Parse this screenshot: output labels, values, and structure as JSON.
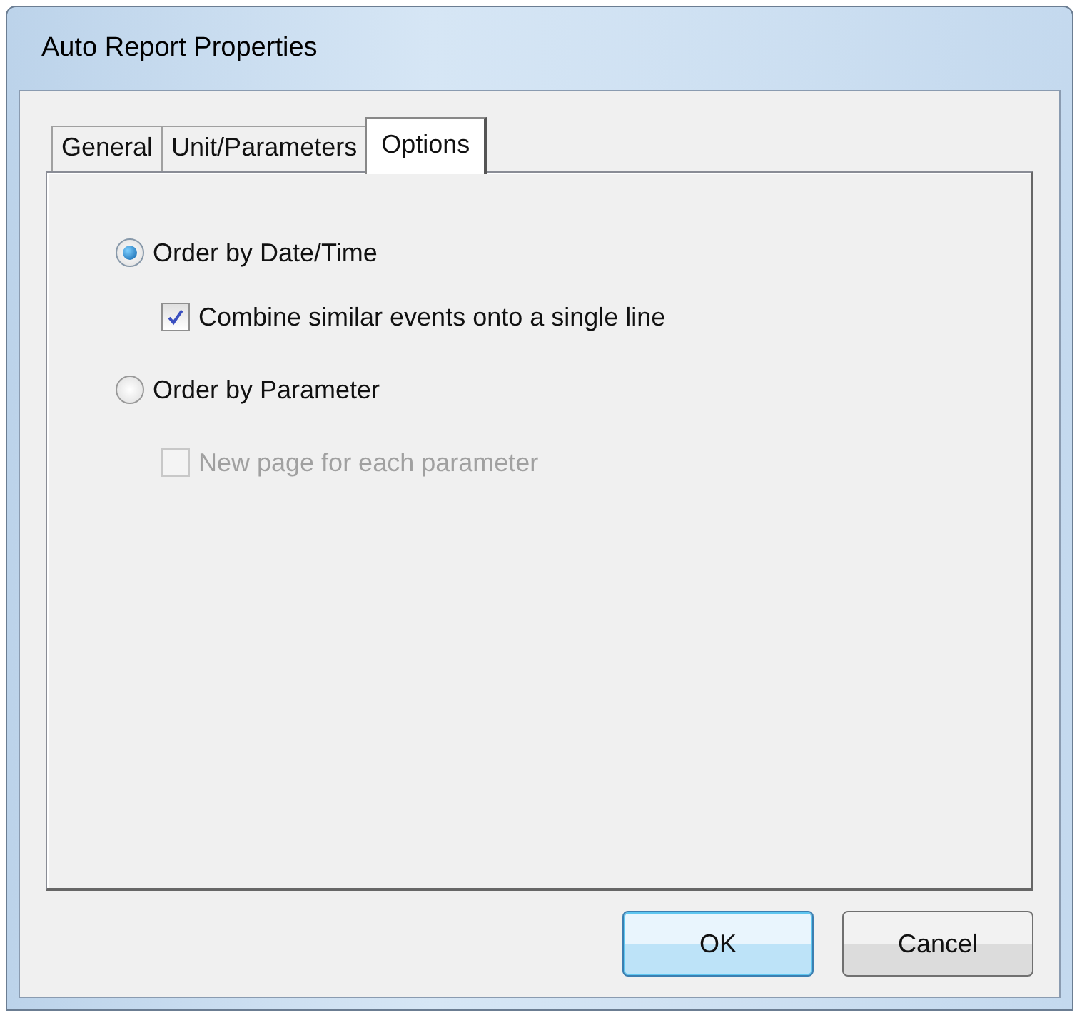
{
  "window": {
    "title": "Auto Report Properties"
  },
  "tabs": [
    {
      "label": "General",
      "selected": false
    },
    {
      "label": "Unit/Parameters",
      "selected": false
    },
    {
      "label": "Options",
      "selected": true
    }
  ],
  "options": [
    {
      "kind": "radio",
      "label": "Order by Date/Time",
      "selected": true,
      "children": [
        {
          "kind": "checkbox",
          "label": "Combine similar events onto a single line",
          "checked": true,
          "disabled": false
        }
      ]
    },
    {
      "kind": "radio",
      "label": "Order by Parameter",
      "selected": false,
      "children": [
        {
          "kind": "checkbox",
          "label": "New page for each parameter",
          "checked": false,
          "disabled": true
        }
      ]
    }
  ],
  "buttons": [
    {
      "label": "OK",
      "default": true
    },
    {
      "label": "Cancel",
      "default": false
    }
  ]
}
